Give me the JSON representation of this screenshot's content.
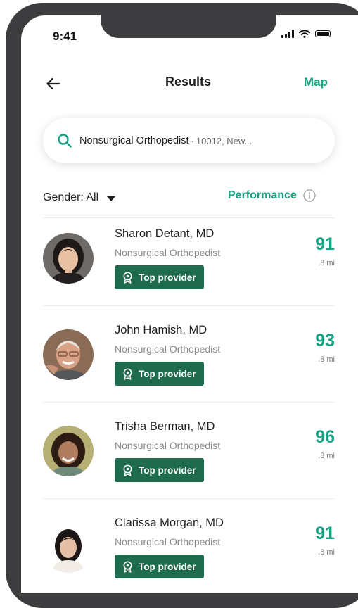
{
  "status_bar": {
    "time": "9:41"
  },
  "header": {
    "title": "Results",
    "map_label": "Map"
  },
  "search": {
    "query": "Nonsurgical Orthopedist",
    "separator": "·",
    "location": "10012, New..."
  },
  "filters": {
    "gender_label": "Gender: All",
    "sort_label": "Performance"
  },
  "providers": [
    {
      "name": "Sharon Detant, MD",
      "specialty": "Nonsurgical Orthopedist",
      "badge": "Top provider",
      "score": "91",
      "distance": ".8 mi"
    },
    {
      "name": "John Hamish, MD",
      "specialty": "Nonsurgical Orthopedist",
      "badge": "Top provider",
      "score": "93",
      "distance": ".8 mi"
    },
    {
      "name": "Trisha Berman, MD",
      "specialty": "Nonsurgical Orthopedist",
      "badge": "Top provider",
      "score": "96",
      "distance": ".8 mi"
    },
    {
      "name": "Clarissa Morgan, MD",
      "specialty": "Nonsurgical Orthopedist",
      "badge": "Top provider",
      "score": "91",
      "distance": ".8 mi"
    }
  ],
  "colors": {
    "accent": "#16a383",
    "badge_bg": "#1f6b4e",
    "frame": "#3d3d3f"
  }
}
